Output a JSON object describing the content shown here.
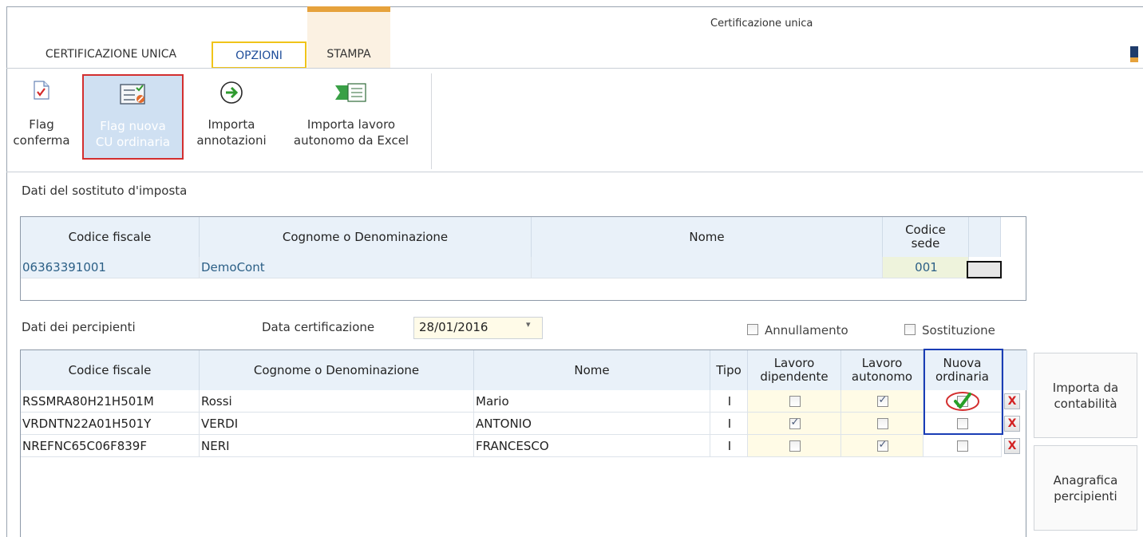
{
  "window": {
    "title": "Certificazione unica"
  },
  "ribbon": {
    "tabs": [
      {
        "label": "CERTIFICAZIONE UNICA"
      },
      {
        "label": "OPZIONI"
      },
      {
        "label": "STAMPA"
      }
    ],
    "buttons": {
      "flag_conferma": {
        "line1": "Flag",
        "line2": "conferma",
        "icon": "document-check-icon"
      },
      "flag_nuova": {
        "line1": "Flag nuova",
        "line2": "CU ordinaria",
        "icon": "form-flag-icon"
      },
      "importa_annotazioni": {
        "line1": "Importa",
        "line2": "annotazioni",
        "icon": "arrow-right-circle-icon"
      },
      "importa_lavoro": {
        "line1": "Importa lavoro",
        "line2": "autonomo da Excel",
        "icon": "excel-import-icon"
      }
    }
  },
  "sostituto": {
    "section_label": "Dati del sostituto d'imposta",
    "headers": {
      "codice_fiscale": "Codice fiscale",
      "cognome": "Cognome o Denominazione",
      "nome": "Nome",
      "codice_sede_1": "Codice",
      "codice_sede_2": "sede"
    },
    "row": {
      "codice_fiscale": "06363391001",
      "cognome": "DemoCont",
      "nome": "",
      "codice_sede": "001"
    }
  },
  "percipienti": {
    "section_label": "Dati dei percipienti",
    "data_cert_label": "Data certificazione",
    "data_cert_value": "28/01/2016",
    "annullamento_label": "Annullamento",
    "sostituzione_label": "Sostituzione",
    "headers": {
      "codice_fiscale": "Codice fiscale",
      "cognome": "Cognome o Denominazione",
      "nome": "Nome",
      "tipo": "Tipo",
      "lavoro_dip_1": "Lavoro",
      "lavoro_dip_2": "dipendente",
      "lavoro_aut_1": "Lavoro",
      "lavoro_aut_2": "autonomo",
      "nuova_1": "Nuova",
      "nuova_2": "ordinaria"
    },
    "rows": [
      {
        "codice_fiscale": "RSSMRA80H21H501M",
        "cognome": "Rossi",
        "nome": "Mario",
        "tipo": "I",
        "lavoro_dipendente": false,
        "lavoro_autonomo": true,
        "nuova_ordinaria": true
      },
      {
        "codice_fiscale": "VRDNTN22A01H501Y",
        "cognome": "VERDI",
        "nome": "ANTONIO",
        "tipo": "I",
        "lavoro_dipendente": true,
        "lavoro_autonomo": false,
        "nuova_ordinaria": false
      },
      {
        "codice_fiscale": "NREFNC65C06F839F",
        "cognome": "NERI",
        "nome": "FRANCESCO",
        "tipo": "I",
        "lavoro_dipendente": false,
        "lavoro_autonomo": true,
        "nuova_ordinaria": false
      }
    ],
    "delete_glyph": "X"
  },
  "side_buttons": {
    "importa_1": "Importa da",
    "importa_2": "contabilità",
    "anagrafica_1": "Anagrafica",
    "anagrafica_2": "percipienti"
  },
  "colors": {
    "accent_orange": "#e6a23c",
    "highlight_yellow": "#f0c419",
    "annotation_red": "#d32f2f",
    "annotation_blue": "#1a3db5",
    "header_bg": "#e9f1f9"
  }
}
